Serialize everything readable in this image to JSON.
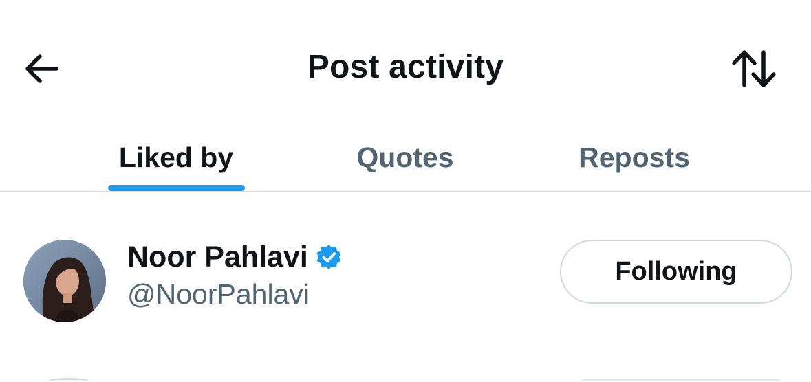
{
  "header": {
    "title": "Post activity",
    "back_icon": "arrow-left-icon",
    "sort_icon": "sort-arrows-icon"
  },
  "tabs": [
    {
      "label": "Liked by",
      "active": true
    },
    {
      "label": "Quotes",
      "active": false
    },
    {
      "label": "Reposts",
      "active": false
    }
  ],
  "users": [
    {
      "name": "Noor Pahlavi",
      "handle": "@NoorPahlavi",
      "verified": true,
      "button_label": "Following"
    }
  ],
  "colors": {
    "accent": "#1d9bf0",
    "text_primary": "#0f1419",
    "text_secondary": "#536471",
    "divider": "#cfd9de",
    "verified_badge": "#1d9bf0"
  }
}
